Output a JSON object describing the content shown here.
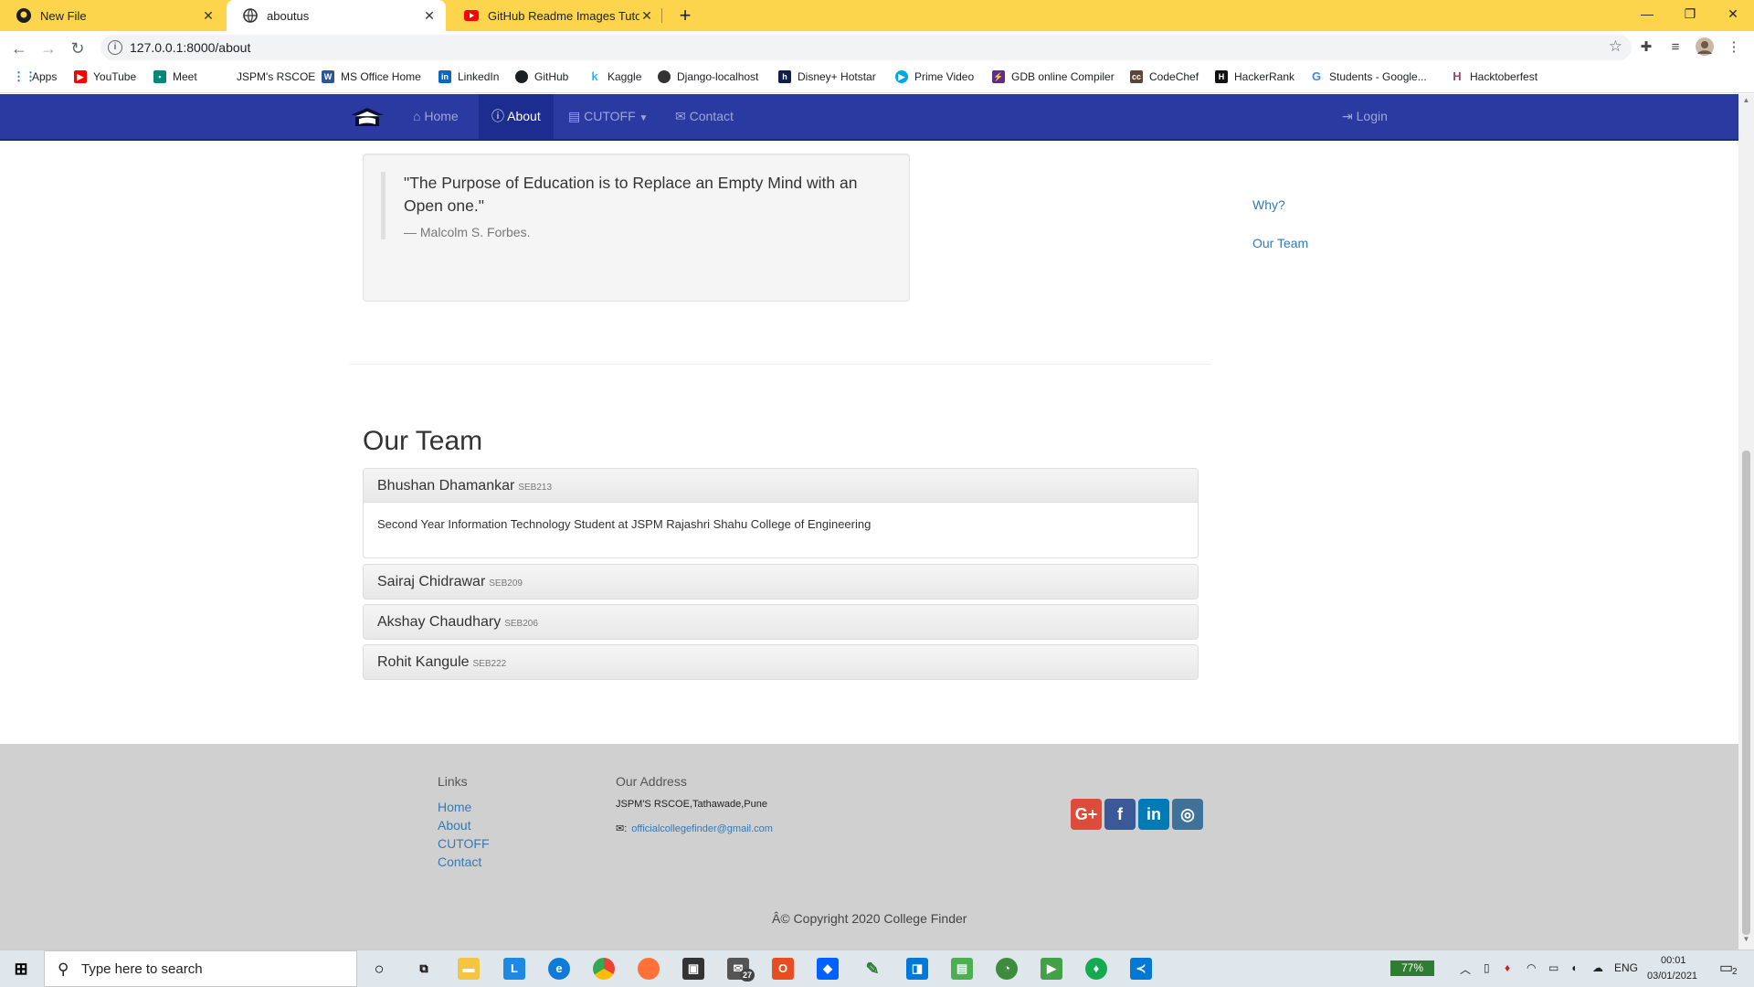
{
  "browser": {
    "tabs": [
      {
        "title": "New File",
        "active": false
      },
      {
        "title": "aboutus",
        "active": true
      },
      {
        "title": "GitHub Readme Images Tutorial | ",
        "active": false
      }
    ],
    "new_tab": "+",
    "window_controls": [
      "—",
      "❐",
      "✕"
    ],
    "url": "127.0.0.1:8000/about",
    "bookmarks": [
      "Apps",
      "YouTube",
      "Meet",
      "JSPM's RSCOE",
      "MS Office Home",
      "LinkedIn",
      "GitHub",
      "Kaggle",
      "Django-localhost",
      "Disney+ Hotstar",
      "Prime Video",
      "GDB online Compiler",
      "CodeChef",
      "HackerRank",
      "Students - Google...",
      "Hacktoberfest"
    ]
  },
  "site_nav": {
    "home": "Home",
    "about": "About",
    "cutoff": "CUTOFF",
    "contact": "Contact",
    "login": "Login"
  },
  "quote": {
    "text": "\"The Purpose of Education is to Replace an Empty Mind with an Open one.\"",
    "author": "— Malcolm S. Forbes."
  },
  "side_nav": [
    "Why?",
    "Our Team"
  ],
  "team": {
    "title": "Our Team",
    "members": [
      {
        "name": "Bhushan Dhamankar",
        "id": "SEB213",
        "bio": "Second Year Information Technology Student at JSPM Rajashri Shahu College of Engineering"
      },
      {
        "name": "Sairaj Chidrawar",
        "id": "SEB209"
      },
      {
        "name": "Akshay Chaudhary",
        "id": "SEB206"
      },
      {
        "name": "Rohit Kangule",
        "id": "SEB222"
      }
    ]
  },
  "footer": {
    "links_heading": "Links",
    "links": [
      "Home",
      "About",
      "CUTOFF",
      "Contact"
    ],
    "address_heading": "Our Address",
    "address": "JSPM'S RSCOE,Tathawade,Pune",
    "email": "officialcollegefinder@gmail.com",
    "social": [
      "G+",
      "f",
      "in",
      "◎"
    ],
    "copyright": "Â© Copyright 2020 College Finder"
  },
  "taskbar": {
    "search_placeholder": "Type here to search",
    "battery": "77%",
    "language": "ENG",
    "time": "00:01",
    "date": "03/01/2021",
    "mail_badge": "27",
    "notif_badge": "2"
  },
  "colors": {
    "tabstrip": "#fcd54d",
    "site_nav": "#2b3aa0",
    "link": "#337ab7",
    "footer": "#d0d0d0"
  }
}
